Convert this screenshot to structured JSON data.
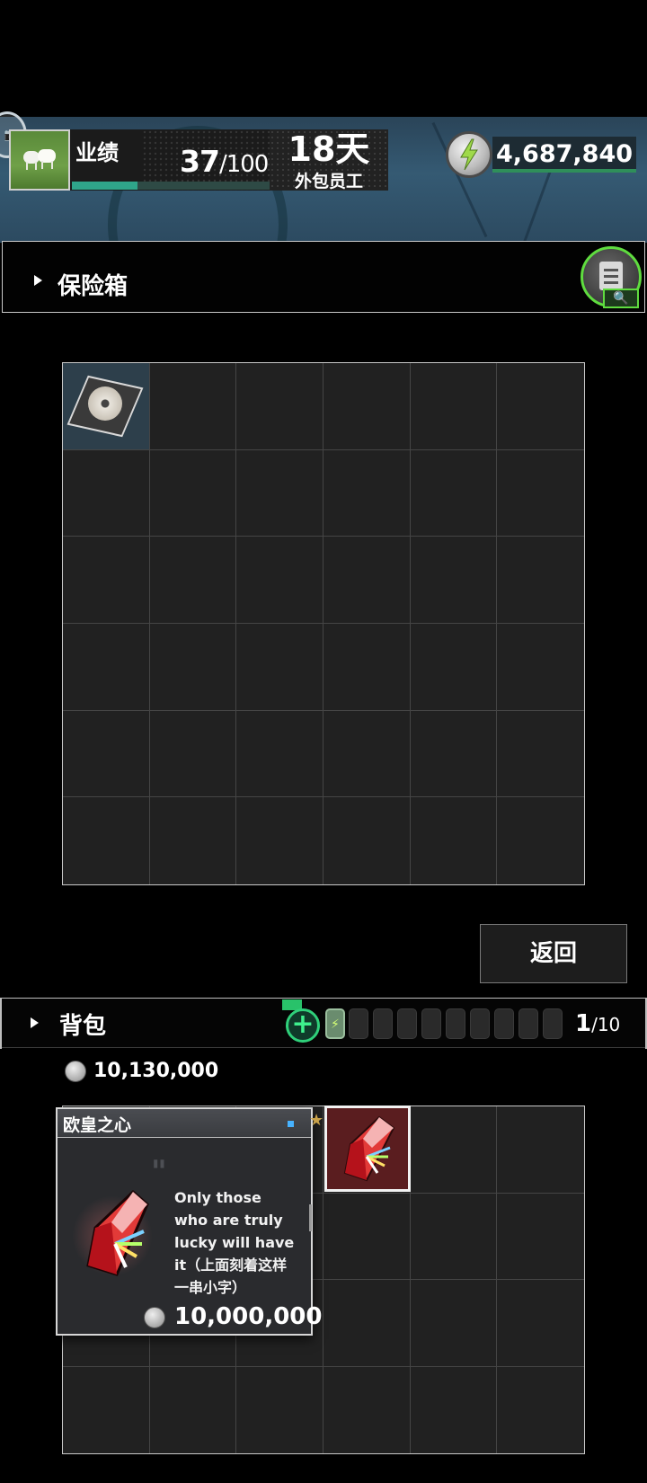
{
  "header": {
    "settings_icon": "camera-icon",
    "settings_glyph": "📷",
    "performance_label": "业绩",
    "performance_current": "37",
    "performance_max": "/100",
    "performance_progress": 0.37,
    "days": "18天",
    "role": "外包员工",
    "currency_icon": "energy-coin-icon",
    "money": "4,687,840",
    "progress_color": "#2fa58a"
  },
  "safe": {
    "title": "保险箱",
    "search_icon": "clipboard-search-icon",
    "search_glyph": "🔍",
    "grid_rows": 6,
    "grid_cols": 6,
    "items": [
      {
        "name": "disc-case-item",
        "row": 0,
        "col": 0
      }
    ]
  },
  "actions": {
    "return_label": "返回"
  },
  "backpack": {
    "title": "背包",
    "add_glyph": "+",
    "count_current": "1",
    "count_max": "/10",
    "money": "10,130,000",
    "grid_rows": 4,
    "grid_cols": 6
  },
  "tooltip": {
    "name": "欧皇之心",
    "quote_glyph": "\"",
    "description": "Only those who are truly lucky will have it（上面刻着这样一串小字）",
    "price": "10,000,000",
    "star_glyph": "★",
    "accent_color": "#47b3ff"
  }
}
